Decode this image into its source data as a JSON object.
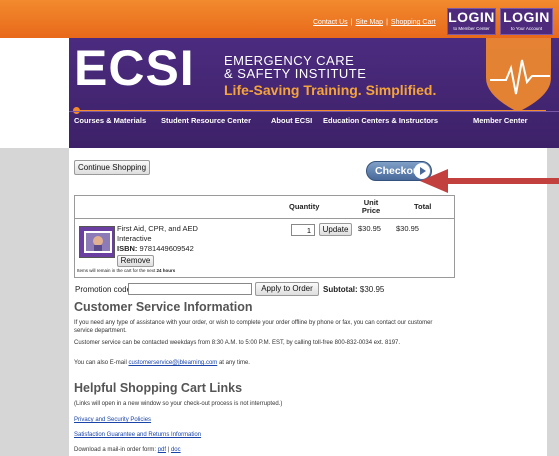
{
  "top_links": {
    "contact": "Contact Us",
    "sitemap": "Site Map",
    "cart": "Shopping Cart",
    "sep": "|"
  },
  "login_member": {
    "title": "LOGIN",
    "sub": "to Member Center"
  },
  "login_account": {
    "title": "LOGIN",
    "sub": "to Your Account"
  },
  "brand": {
    "logo": "ECSI",
    "line1": "EMERGENCY CARE",
    "line2": "& SAFETY INSTITUTE",
    "tagline": "Life-Saving Training. Simplified."
  },
  "nav": [
    "Courses & Materials",
    "Student Resource Center",
    "About ECSI",
    "Education Centers & Instructors",
    "Member Center"
  ],
  "cart": {
    "continue_label": "Continue Shopping",
    "checkout_label": "Checkout",
    "col_quantity": "Quantity",
    "col_unit_price": "Unit\nPrice",
    "col_total": "Total",
    "item": {
      "title_line1": "First Aid, CPR, and AED",
      "title_line2": "Interactive",
      "isbn_label": "ISBN:",
      "isbn": "9781449609542",
      "quantity": "1",
      "unit_price": "$30.95",
      "total": "$30.95",
      "remove_label": "Remove",
      "update_label": "Update"
    },
    "note": "Items will remain in the cart for the next",
    "note_bold": "24 hours",
    "promo_label": "Promotion code:",
    "apply_label": "Apply to Order",
    "subtotal_label": "Subtotal:",
    "subtotal": "$30.95"
  },
  "service": {
    "heading": "Customer Service Information",
    "p1": "If you need any type of assistance with your order, or wish to complete your order offline by phone or fax, you can contact our customer service department.",
    "p2": "Customer service can be contacted weekdays from 8:30 A.M. to 5:00 P.M. EST, by calling toll-free 800-832-0034 ext. 8197.",
    "p3_pre": "You can also E-mail",
    "email": "customerservice@jblearning.com",
    "p3_post": "at any time."
  },
  "help": {
    "heading": "Helpful Shopping Cart Links",
    "note": "(Links will open in a new window so your check-out process is not interrupted.)",
    "link1": "Privacy and Security Policies",
    "link2": "Satisfaction Guarantee and Returns Information",
    "download_pre": "Download a mail-in order form:",
    "pdf": "pdf",
    "sep": "|",
    "doc": "doc"
  },
  "colors": {
    "orange": "#f28a2e",
    "purple": "#4b2b7f",
    "checkout_blue": "#48699a",
    "arrow_red": "#c2413f"
  }
}
